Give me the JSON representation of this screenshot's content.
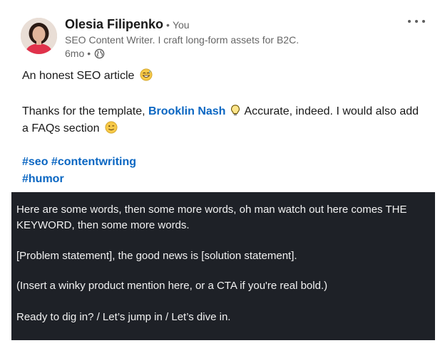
{
  "post": {
    "author": {
      "name": "Olesia Filipenko",
      "relation": "You",
      "headline": "SEO Content Writer. I craft long-form assets for B2C.",
      "time": "6mo",
      "visibility_icon": "globe-icon"
    },
    "line1": "An honest SEO article",
    "line2_before": "Thanks for the template,",
    "mention": "Brooklin Nash",
    "line2_after": "Accurate, indeed. I would also add a FAQs section",
    "hashtags": [
      "#seo",
      "#contentwriting",
      "#humor"
    ],
    "image_text": [
      "Here are some words, then some more words, oh man watch out here comes THE KEYWORD, then some more words.",
      "[Problem statement], the good news is [solution statement].",
      "(Insert a winky product mention here, or a CTA if you're real bold.)",
      "Ready to dig in? / Let’s jump in / Let’s dive in."
    ]
  },
  "colors": {
    "link": "#0a66c2",
    "image_bg": "#1e2127",
    "secondary_text": "#666666"
  }
}
